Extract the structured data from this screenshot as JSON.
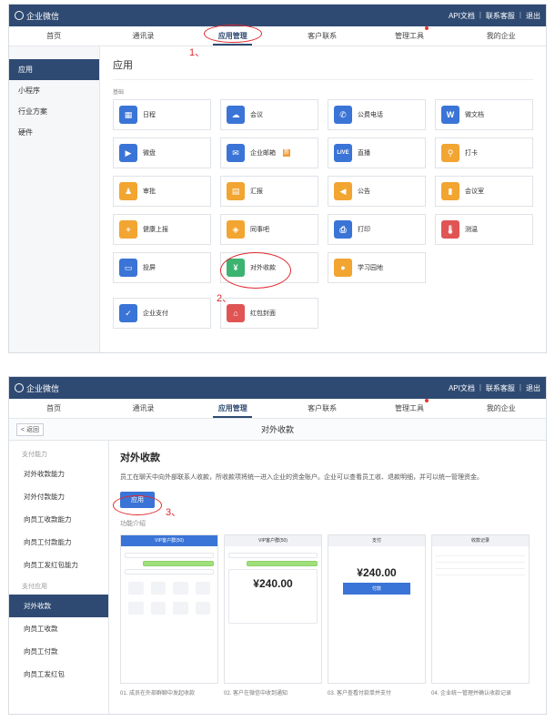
{
  "header": {
    "brand": "企业微信",
    "links": [
      "API文档",
      "联系客服",
      "退出"
    ]
  },
  "nav": [
    "首页",
    "通讯录",
    "应用管理",
    "客户联系",
    "管理工具",
    "我的企业"
  ],
  "annotations": [
    "1、",
    "2、",
    "3、"
  ],
  "shot1": {
    "sidebar": [
      "应用",
      "小程序",
      "行业方案",
      "硬件"
    ],
    "title": "应用",
    "group": "基础",
    "apps": [
      {
        "label": "日程",
        "icon": "calendar-icon",
        "color": "#3a74d6",
        "glyph": "▦"
      },
      {
        "label": "会议",
        "icon": "cloud-icon",
        "color": "#3a74d6",
        "glyph": "☁"
      },
      {
        "label": "公费电话",
        "icon": "phone-icon",
        "color": "#3a74d6",
        "glyph": "✆"
      },
      {
        "label": "微文档",
        "icon": "word-icon",
        "color": "#3a74d6",
        "glyph": "W"
      },
      {
        "label": "微盘",
        "icon": "drive-icon",
        "color": "#3a74d6",
        "glyph": "▶"
      },
      {
        "label": "企业邮箱",
        "icon": "mail-icon",
        "color": "#3a74d6",
        "glyph": "✉",
        "badge": "新"
      },
      {
        "label": "直播",
        "icon": "live-icon",
        "color": "#3a74d6",
        "glyph": "LIVE"
      },
      {
        "label": "打卡",
        "icon": "location-icon",
        "color": "#f2a531",
        "glyph": "⚲"
      },
      {
        "label": "审批",
        "icon": "stamp-icon",
        "color": "#f2a531",
        "glyph": "♟"
      },
      {
        "label": "汇报",
        "icon": "report-icon",
        "color": "#f2a531",
        "glyph": "▤"
      },
      {
        "label": "公告",
        "icon": "megaphone-icon",
        "color": "#f2a531",
        "glyph": "◀"
      },
      {
        "label": "会议室",
        "icon": "room-icon",
        "color": "#f2a531",
        "glyph": "▮"
      },
      {
        "label": "健康上报",
        "icon": "health-icon",
        "color": "#f2a531",
        "glyph": "+"
      },
      {
        "label": "同事吧",
        "icon": "colleague-icon",
        "color": "#f2a531",
        "glyph": "◈"
      },
      {
        "label": "打印",
        "icon": "printer-icon",
        "color": "#3a74d6",
        "glyph": "⎙"
      },
      {
        "label": "测温",
        "icon": "thermometer-icon",
        "color": "#e05454",
        "glyph": "🌡"
      },
      {
        "label": "投屏",
        "icon": "cast-icon",
        "color": "#3a74d6",
        "glyph": "▭"
      },
      {
        "label": "对外收款",
        "icon": "payment-icon",
        "color": "#3cb371",
        "glyph": "¥"
      },
      {
        "label": "学习园地",
        "icon": "learning-icon",
        "color": "#f2a531",
        "glyph": "●"
      }
    ],
    "apps2": [
      {
        "label": "企业支付",
        "icon": "pay-icon",
        "color": "#3a74d6",
        "glyph": "✓"
      },
      {
        "label": "红包封面",
        "icon": "redpacket-icon",
        "color": "#e05454",
        "glyph": "⌂"
      }
    ]
  },
  "shot2": {
    "back": "返回",
    "subtitle": "对外收款",
    "sidebar": [
      {
        "type": "cat",
        "label": "支付能力"
      },
      {
        "type": "item",
        "label": "对外收款能力"
      },
      {
        "type": "item",
        "label": "对外付款能力"
      },
      {
        "type": "item",
        "label": "向员工收款能力"
      },
      {
        "type": "item",
        "label": "向员工付款能力"
      },
      {
        "type": "item",
        "label": "向员工发红包能力"
      },
      {
        "type": "cat",
        "label": "支付应用"
      },
      {
        "type": "item",
        "label": "对外收款",
        "active": true
      },
      {
        "type": "item",
        "label": "向员工收款"
      },
      {
        "type": "item",
        "label": "向员工付款"
      },
      {
        "type": "item",
        "label": "向员工发红包"
      }
    ],
    "title": "对外收款",
    "desc": "员工在聊天中向外部联系人收款，所收款项将统一进入企业的资金账户。企业可以查看员工收、退款明细，并可以统一管理资金。",
    "apply": "应用",
    "features_title": "功能介绍",
    "phone1_bar": "VIP客户群(50)",
    "phone2_bar": "VIP客户群(50)",
    "phone3_bar": "支付",
    "phone4_bar": "收款记录",
    "amount": "¥240.00",
    "pay_label": "付款",
    "captions": [
      "01. 成员在外部群聊中发起收款",
      "02. 客户在微信中收到通知",
      "03. 客户查看付款单并支付",
      "04. 企业统一管理并确认收款记录"
    ]
  }
}
